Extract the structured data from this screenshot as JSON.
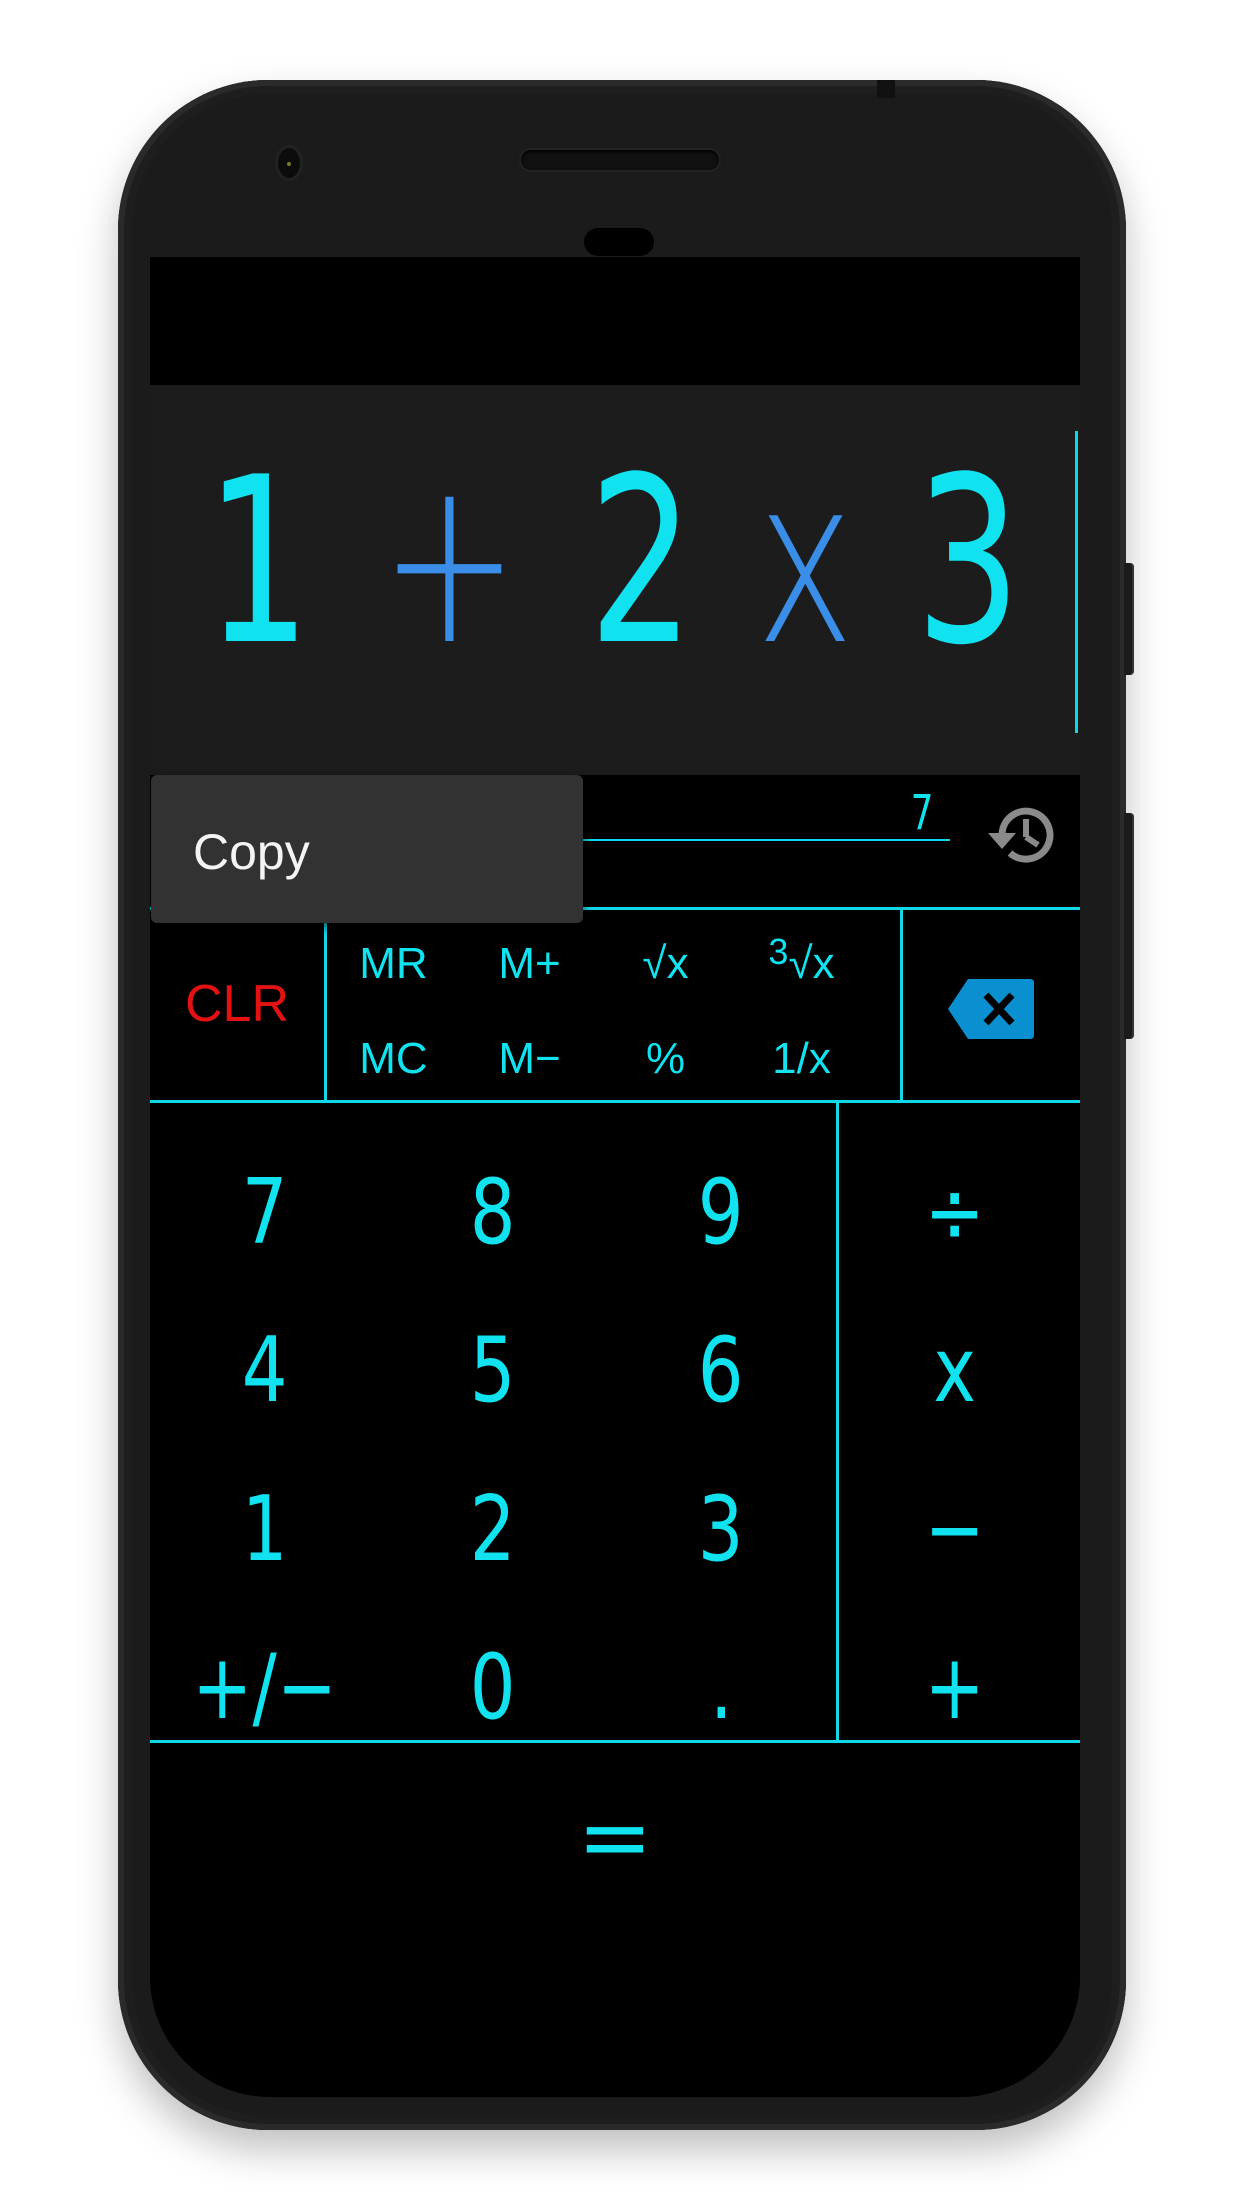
{
  "display": {
    "expression": [
      {
        "text": "1",
        "kind": "digit"
      },
      {
        "text": "+",
        "kind": "operator"
      },
      {
        "text": "2",
        "kind": "digit"
      },
      {
        "text": "x",
        "kind": "operator"
      },
      {
        "text": "3",
        "kind": "digit"
      }
    ],
    "result": "7"
  },
  "context_menu": {
    "copy_label": "Copy"
  },
  "function_keys": {
    "clear": "CLR",
    "row1": [
      "MR",
      "M+",
      "√x",
      "√x"
    ],
    "cube_root_index": "3",
    "row2": [
      "MC",
      "M−",
      "%",
      "1/x"
    ]
  },
  "keypad": {
    "rows": [
      [
        "7",
        "8",
        "9",
        "÷"
      ],
      [
        "4",
        "5",
        "6",
        "x"
      ],
      [
        "1",
        "2",
        "3",
        "−"
      ],
      [
        "+/−",
        "0",
        ".",
        "+"
      ]
    ],
    "equals": "="
  },
  "icons": {
    "history": "history-icon",
    "backspace": "backspace-icon"
  },
  "colors": {
    "digits": "#10e3ef",
    "operators": "#3b8ee8",
    "clear": "#e31212",
    "backspace": "#0a8fd0",
    "history": "#8a8a8a",
    "display_bg": "#1c1c1c",
    "popup_bg": "#323232"
  }
}
